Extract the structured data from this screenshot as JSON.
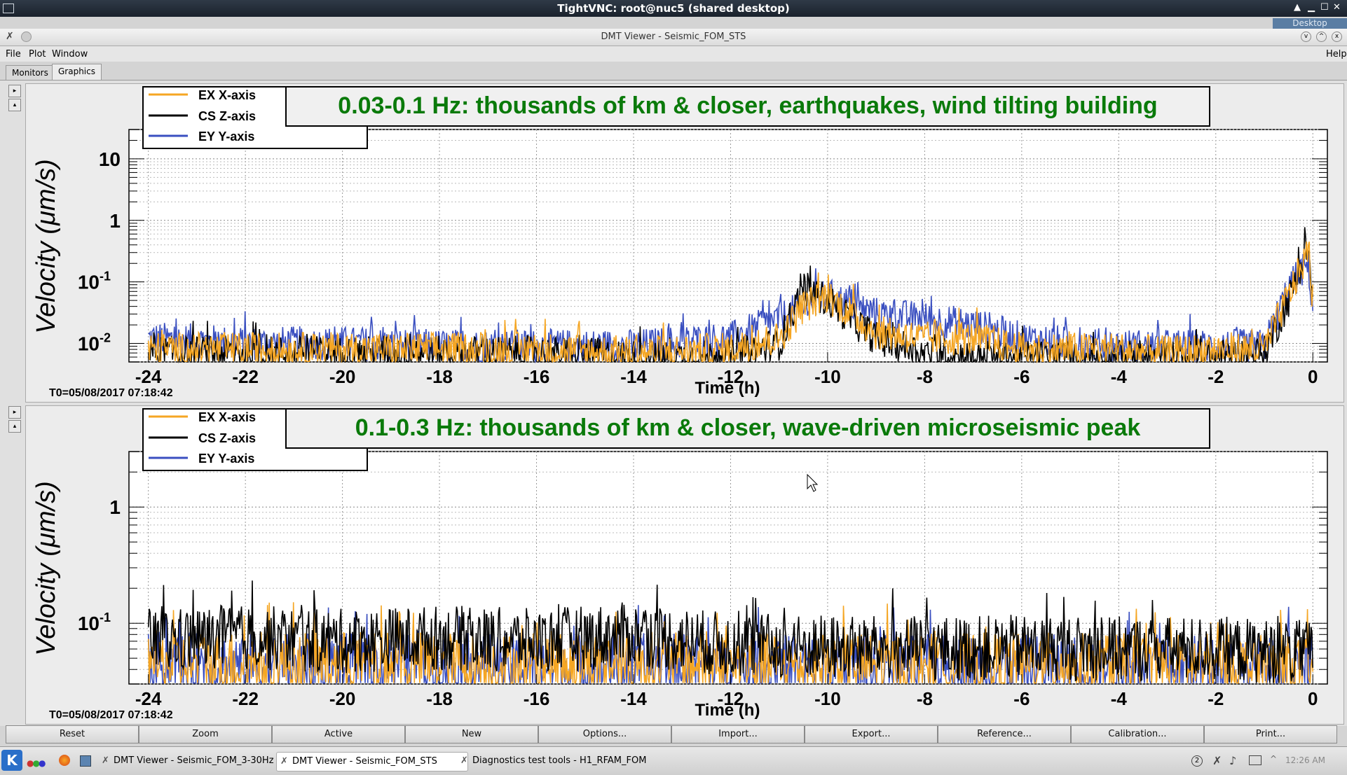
{
  "vnc": {
    "title": "TightVNC: root@nuc5 (shared desktop)",
    "desktop_label": "Desktop"
  },
  "window": {
    "title": "DMT Viewer - Seismic_FOM_STS"
  },
  "menu": {
    "file": "File",
    "plot": "Plot",
    "window": "Window",
    "help": "Help"
  },
  "tabs": [
    {
      "label": "Monitors"
    },
    {
      "label": "Graphics",
      "selected": true
    }
  ],
  "toolbar": {
    "buttons": [
      "Reset",
      "Zoom",
      "Active",
      "New",
      "Options...",
      "Import...",
      "Export...",
      "Reference...",
      "Calibration...",
      "Print..."
    ]
  },
  "taskbar": {
    "tasks": [
      {
        "label": "DMT Viewer - Seismic_FOM_3-30Hz",
        "active": false
      },
      {
        "label": "DMT Viewer - Seismic_FOM_STS",
        "active": true
      },
      {
        "label": "Diagnostics test tools - H1_RFAM_FOM",
        "active": false
      }
    ],
    "clock": "12:26 AM"
  },
  "colors": {
    "ex_series": "#f5a623",
    "cs_series": "#000000",
    "ey_series": "#3a4fc0",
    "annotation_text": "#0a7a0a"
  },
  "chart_data": [
    {
      "type": "line",
      "title": "0.03-0.1 Hz: thousands of km & closer, earthquakes, wind tilting building",
      "xlabel": "Time (h)",
      "ylabel": "Velocity  (μm/s)",
      "t0_label": "T0=05/08/2017 07:18:42",
      "xlim": [
        -24.4,
        0.3
      ],
      "ylim": [
        0.005,
        30
      ],
      "yscale": "log",
      "x_ticks": [
        -24,
        -22,
        -20,
        -18,
        -16,
        -14,
        -12,
        -10,
        -8,
        -6,
        -4,
        -2,
        0
      ],
      "y_ticks": [
        {
          "v": 10,
          "base": "10",
          "exp": ""
        },
        {
          "v": 1,
          "base": "1",
          "exp": ""
        },
        {
          "v": 0.1,
          "base": "10",
          "exp": "-1"
        },
        {
          "v": 0.01,
          "base": "10",
          "exp": "-2"
        }
      ],
      "grid": true,
      "legend_position": "top-left",
      "x": [
        -24,
        -22,
        -20,
        -18,
        -16,
        -14,
        -12,
        -11,
        -10.5,
        -10,
        -9,
        -8,
        -7,
        -6,
        -5,
        -4,
        -3,
        -2,
        -1,
        -0.5,
        -0.1,
        0
      ],
      "series": [
        {
          "name": "EX X-axis",
          "color": "#f5a623",
          "values": [
            0.008,
            0.008,
            0.008,
            0.008,
            0.008,
            0.007,
            0.008,
            0.012,
            0.04,
            0.06,
            0.015,
            0.012,
            0.012,
            0.008,
            0.008,
            0.008,
            0.007,
            0.008,
            0.008,
            0.06,
            0.3,
            0.05
          ]
        },
        {
          "name": "CS Z-axis",
          "color": "#000000",
          "values": [
            0.007,
            0.007,
            0.007,
            0.007,
            0.007,
            0.006,
            0.006,
            0.01,
            0.08,
            0.05,
            0.012,
            0.007,
            0.006,
            0.006,
            0.006,
            0.006,
            0.006,
            0.006,
            0.007,
            0.05,
            0.4,
            0.05
          ]
        },
        {
          "name": "EY Y-axis",
          "color": "#3a4fc0",
          "values": [
            0.012,
            0.01,
            0.01,
            0.009,
            0.009,
            0.009,
            0.012,
            0.025,
            0.04,
            0.06,
            0.03,
            0.025,
            0.02,
            0.012,
            0.01,
            0.009,
            0.009,
            0.009,
            0.009,
            0.08,
            0.2,
            0.04
          ]
        }
      ]
    },
    {
      "type": "line",
      "title": "0.1-0.3 Hz: thousands of km & closer, wave-driven microseismic peak",
      "xlabel": "Time (h)",
      "ylabel": "Velocity  (μm/s)",
      "t0_label": "T0=05/08/2017 07:18:42",
      "xlim": [
        -24.4,
        0.3
      ],
      "ylim": [
        0.03,
        3
      ],
      "yscale": "log",
      "x_ticks": [
        -24,
        -22,
        -20,
        -18,
        -16,
        -14,
        -12,
        -10,
        -8,
        -6,
        -4,
        -2,
        0
      ],
      "y_ticks": [
        {
          "v": 1,
          "base": "1",
          "exp": ""
        },
        {
          "v": 0.1,
          "base": "10",
          "exp": "-1"
        }
      ],
      "grid": true,
      "legend_position": "top-left",
      "x": [
        -24,
        -22,
        -20,
        -18,
        -16,
        -14,
        -12,
        -10,
        -8,
        -6,
        -4,
        -2,
        0
      ],
      "series": [
        {
          "name": "EX X-axis",
          "color": "#f5a623",
          "values": [
            0.045,
            0.045,
            0.045,
            0.045,
            0.045,
            0.045,
            0.044,
            0.044,
            0.043,
            0.044,
            0.043,
            0.043,
            0.04
          ]
        },
        {
          "name": "CS Z-axis",
          "color": "#000000",
          "values": [
            0.07,
            0.075,
            0.07,
            0.075,
            0.07,
            0.08,
            0.065,
            0.062,
            0.06,
            0.062,
            0.06,
            0.06,
            0.055
          ]
        },
        {
          "name": "EY Y-axis",
          "color": "#3a4fc0",
          "values": [
            0.045,
            0.043,
            0.043,
            0.043,
            0.043,
            0.043,
            0.043,
            0.042,
            0.042,
            0.042,
            0.042,
            0.042,
            0.04
          ]
        }
      ]
    }
  ]
}
